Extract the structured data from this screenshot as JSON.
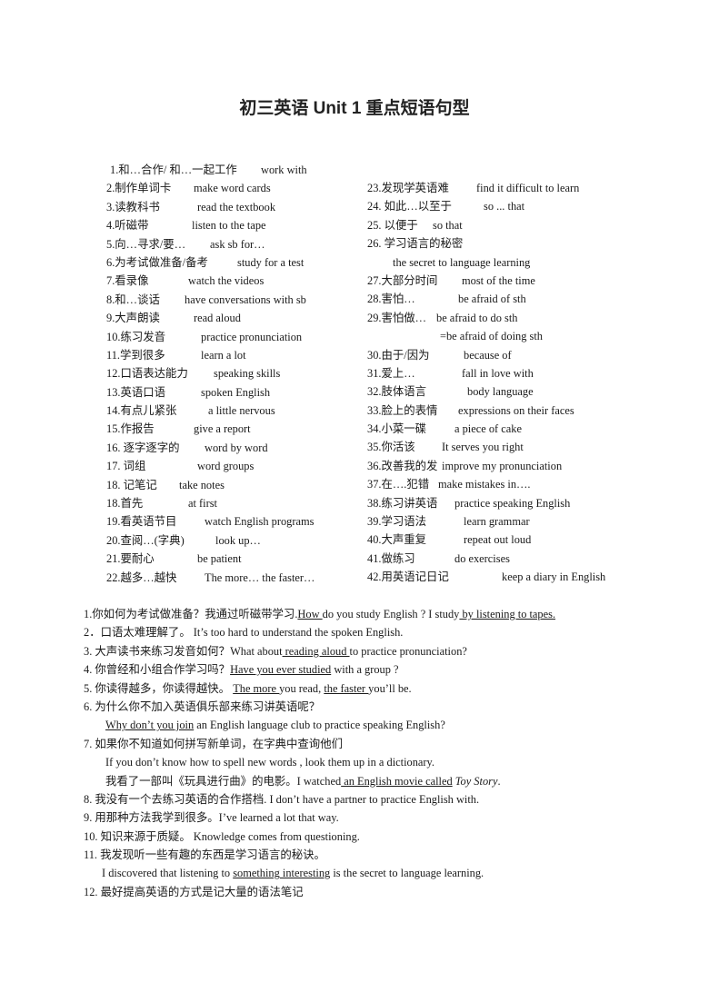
{
  "title": "初三英语 Unit 1 重点短语句型",
  "phrases_left": [
    {
      "cn": "1.和…合作/  和…一起工作",
      "en": "work with"
    },
    {
      "cn": "2.制作单词卡",
      "en": "make word cards"
    },
    {
      "cn": "3.读教科书",
      "en": "read the textbook"
    },
    {
      "cn": "4.听磁带",
      "en": "listen to the tape"
    },
    {
      "cn": "5.向…寻求/要…",
      "en": "ask sb for…"
    },
    {
      "cn": "6.为考试做准备/备考",
      "en": "study for a test"
    },
    {
      "cn": "7.看录像",
      "en": "watch the videos"
    },
    {
      "cn": "8.和…谈话",
      "en": "have conversations with sb"
    },
    {
      "cn": "9.大声朗读",
      "en": "read aloud"
    },
    {
      "cn": "10.练习发音",
      "en": "practice pronunciation"
    },
    {
      "cn": "11.学到很多",
      "en": "learn a lot"
    },
    {
      "cn": "12.口语表达能力",
      "en": "speaking skills"
    },
    {
      "cn": "13.英语口语",
      "en": "spoken English"
    },
    {
      "cn": "14.有点儿紧张",
      "en": "a little nervous"
    },
    {
      "cn": "15.作报告",
      "en": "give a report"
    },
    {
      "cn": "16.  逐字逐字的",
      "en": "word by word"
    },
    {
      "cn": "17.  词组",
      "en": "word groups"
    },
    {
      "cn": "18.  记笔记",
      "en": "take notes"
    },
    {
      "cn": "18.首先",
      "en": "at first"
    },
    {
      "cn": "19.看英语节目",
      "en": "watch English programs"
    },
    {
      "cn": "20.查阅…(字典)",
      "en": "look up…"
    },
    {
      "cn": "21.要耐心",
      "en": "be patient"
    },
    {
      "cn": "22.越多…越快",
      "en": "The more… the faster…"
    }
  ],
  "phrases_right": [
    {
      "cn": "23.发现学英语难",
      "en": "find it difficult to learn"
    },
    {
      "cn": "24.  如此…以至于",
      "en": "so ... that"
    },
    {
      "cn": "25.  以便于",
      "en": "so that"
    },
    {
      "cn": "26.  学习语言的秘密",
      "en": ""
    },
    {
      "cn": "",
      "en": "the secret to language learning"
    },
    {
      "cn": "27.大部分时间",
      "en": "most of the time"
    },
    {
      "cn": "28.害怕…",
      "en": "be afraid of sth"
    },
    {
      "cn": "29.害怕做…",
      "en": "be afraid to do sth"
    },
    {
      "cn": "",
      "en": "=be afraid of doing sth"
    },
    {
      "cn": "30.由于/因为",
      "en": "because of"
    },
    {
      "cn": "31.爱上…",
      "en": "fall in love with"
    },
    {
      "cn": "32.肢体语言",
      "en": "body language"
    },
    {
      "cn": "33.脸上的表情",
      "en": "expressions on their faces"
    },
    {
      "cn": "34.小菜一碟",
      "en": "a piece of cake"
    },
    {
      "cn": "35.你活该",
      "en": "It serves you right"
    },
    {
      "cn": "36.改善我的发",
      "en": "improve my pronunciation"
    },
    {
      "cn": "37.在….犯错",
      "en": "make mistakes in…."
    },
    {
      "cn": "38.练习讲英语",
      "en": "practice speaking English"
    },
    {
      "cn": "39.学习语法",
      "en": "learn grammar"
    },
    {
      "cn": "40.大声重复",
      "en": "repeat out loud"
    },
    {
      "cn": "41.做练习",
      "en": "do exercises"
    },
    {
      "cn": "42.用英语记日记",
      "en": "keep a diary in English"
    }
  ],
  "sentences": [
    {
      "indent": 0,
      "parts": [
        {
          "t": "1.你如何为考试做准备？我通过听磁带学习."
        },
        {
          "t": "How ",
          "u": true
        },
        {
          "t": "do you study English ? I study"
        },
        {
          "t": " by listening to tapes.",
          "u": true
        }
      ]
    },
    {
      "indent": 0,
      "parts": [
        {
          "t": "2．口语太难理解了。  It’s too hard to understand the spoken English."
        }
      ]
    },
    {
      "indent": 0,
      "parts": [
        {
          "t": "3.    大声读书来练习发音如何？What about"
        },
        {
          "t": " reading aloud ",
          "u": true
        },
        {
          "t": "to practice pronunciation?"
        }
      ]
    },
    {
      "indent": 0,
      "parts": [
        {
          "t": "4.    你曾经和小组合作学习吗？"
        },
        {
          "t": "Have you ever studied",
          "u": true
        },
        {
          "t": " with a group ?"
        }
      ]
    },
    {
      "indent": 0,
      "parts": [
        {
          "t": "5.    你读得越多，你读得越快。  "
        },
        {
          "t": "The more ",
          "u": true
        },
        {
          "t": "you read, "
        },
        {
          "t": "the faster ",
          "u": true
        },
        {
          "t": "you’ll be."
        }
      ]
    },
    {
      "indent": 0,
      "parts": [
        {
          "t": "6.    为什么你不加入英语俱乐部来练习讲英语呢？"
        }
      ]
    },
    {
      "indent": 1,
      "parts": [
        {
          "t": "Why don’t you join",
          "u": true
        },
        {
          "t": " an English language club to practice speaking English?"
        }
      ]
    },
    {
      "indent": 0,
      "parts": [
        {
          "t": "7.    如果你不知道如何拼写新单词，在字典中查询他们"
        }
      ]
    },
    {
      "indent": 1,
      "parts": [
        {
          "t": "If you don’t know how to spell new words , look them up in a dictionary."
        }
      ]
    },
    {
      "indent": 1,
      "parts": [
        {
          "t": "我看了一部叫《玩具进行曲》的电影。I watched"
        },
        {
          "t": " an English movie called",
          "u": true
        },
        {
          "t": " "
        },
        {
          "t": "Toy Story",
          "i": true
        },
        {
          "t": "."
        }
      ]
    },
    {
      "indent": 0,
      "parts": [
        {
          "t": "8.    我没有一个去练习英语的合作搭档. I don’t have a partner to practice English with."
        }
      ]
    },
    {
      "indent": 0,
      "parts": [
        {
          "t": "9.  用那种方法我学到很多。I’ve learned a lot that way."
        }
      ]
    },
    {
      "indent": 0,
      "parts": [
        {
          "t": "10.  知识来源于质疑。  Knowledge comes from questioning."
        }
      ]
    },
    {
      "indent": 0,
      "parts": [
        {
          "t": "11.  我发现听一些有趣的东西是学习语言的秘诀。"
        }
      ]
    },
    {
      "indent": 2,
      "parts": [
        {
          "t": "I discovered that listening to "
        },
        {
          "t": "something interesting",
          "u": true
        },
        {
          "t": " is the secret to language learning."
        }
      ]
    },
    {
      "indent": 0,
      "parts": [
        {
          "t": "12.  最好提高英语的方式是记大量的语法笔记"
        }
      ]
    }
  ]
}
